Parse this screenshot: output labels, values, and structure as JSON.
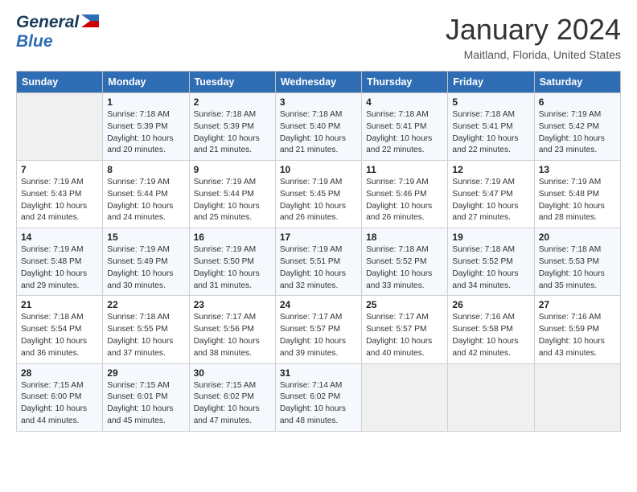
{
  "header": {
    "logo_line1": "General",
    "logo_line2": "Blue",
    "month_year": "January 2024",
    "location": "Maitland, Florida, United States"
  },
  "days_of_week": [
    "Sunday",
    "Monday",
    "Tuesday",
    "Wednesday",
    "Thursday",
    "Friday",
    "Saturday"
  ],
  "weeks": [
    [
      {
        "day": "",
        "info": ""
      },
      {
        "day": "1",
        "info": "Sunrise: 7:18 AM\nSunset: 5:39 PM\nDaylight: 10 hours\nand 20 minutes."
      },
      {
        "day": "2",
        "info": "Sunrise: 7:18 AM\nSunset: 5:39 PM\nDaylight: 10 hours\nand 21 minutes."
      },
      {
        "day": "3",
        "info": "Sunrise: 7:18 AM\nSunset: 5:40 PM\nDaylight: 10 hours\nand 21 minutes."
      },
      {
        "day": "4",
        "info": "Sunrise: 7:18 AM\nSunset: 5:41 PM\nDaylight: 10 hours\nand 22 minutes."
      },
      {
        "day": "5",
        "info": "Sunrise: 7:18 AM\nSunset: 5:41 PM\nDaylight: 10 hours\nand 22 minutes."
      },
      {
        "day": "6",
        "info": "Sunrise: 7:19 AM\nSunset: 5:42 PM\nDaylight: 10 hours\nand 23 minutes."
      }
    ],
    [
      {
        "day": "7",
        "info": "Sunrise: 7:19 AM\nSunset: 5:43 PM\nDaylight: 10 hours\nand 24 minutes."
      },
      {
        "day": "8",
        "info": "Sunrise: 7:19 AM\nSunset: 5:44 PM\nDaylight: 10 hours\nand 24 minutes."
      },
      {
        "day": "9",
        "info": "Sunrise: 7:19 AM\nSunset: 5:44 PM\nDaylight: 10 hours\nand 25 minutes."
      },
      {
        "day": "10",
        "info": "Sunrise: 7:19 AM\nSunset: 5:45 PM\nDaylight: 10 hours\nand 26 minutes."
      },
      {
        "day": "11",
        "info": "Sunrise: 7:19 AM\nSunset: 5:46 PM\nDaylight: 10 hours\nand 26 minutes."
      },
      {
        "day": "12",
        "info": "Sunrise: 7:19 AM\nSunset: 5:47 PM\nDaylight: 10 hours\nand 27 minutes."
      },
      {
        "day": "13",
        "info": "Sunrise: 7:19 AM\nSunset: 5:48 PM\nDaylight: 10 hours\nand 28 minutes."
      }
    ],
    [
      {
        "day": "14",
        "info": "Sunrise: 7:19 AM\nSunset: 5:48 PM\nDaylight: 10 hours\nand 29 minutes."
      },
      {
        "day": "15",
        "info": "Sunrise: 7:19 AM\nSunset: 5:49 PM\nDaylight: 10 hours\nand 30 minutes."
      },
      {
        "day": "16",
        "info": "Sunrise: 7:19 AM\nSunset: 5:50 PM\nDaylight: 10 hours\nand 31 minutes."
      },
      {
        "day": "17",
        "info": "Sunrise: 7:19 AM\nSunset: 5:51 PM\nDaylight: 10 hours\nand 32 minutes."
      },
      {
        "day": "18",
        "info": "Sunrise: 7:18 AM\nSunset: 5:52 PM\nDaylight: 10 hours\nand 33 minutes."
      },
      {
        "day": "19",
        "info": "Sunrise: 7:18 AM\nSunset: 5:52 PM\nDaylight: 10 hours\nand 34 minutes."
      },
      {
        "day": "20",
        "info": "Sunrise: 7:18 AM\nSunset: 5:53 PM\nDaylight: 10 hours\nand 35 minutes."
      }
    ],
    [
      {
        "day": "21",
        "info": "Sunrise: 7:18 AM\nSunset: 5:54 PM\nDaylight: 10 hours\nand 36 minutes."
      },
      {
        "day": "22",
        "info": "Sunrise: 7:18 AM\nSunset: 5:55 PM\nDaylight: 10 hours\nand 37 minutes."
      },
      {
        "day": "23",
        "info": "Sunrise: 7:17 AM\nSunset: 5:56 PM\nDaylight: 10 hours\nand 38 minutes."
      },
      {
        "day": "24",
        "info": "Sunrise: 7:17 AM\nSunset: 5:57 PM\nDaylight: 10 hours\nand 39 minutes."
      },
      {
        "day": "25",
        "info": "Sunrise: 7:17 AM\nSunset: 5:57 PM\nDaylight: 10 hours\nand 40 minutes."
      },
      {
        "day": "26",
        "info": "Sunrise: 7:16 AM\nSunset: 5:58 PM\nDaylight: 10 hours\nand 42 minutes."
      },
      {
        "day": "27",
        "info": "Sunrise: 7:16 AM\nSunset: 5:59 PM\nDaylight: 10 hours\nand 43 minutes."
      }
    ],
    [
      {
        "day": "28",
        "info": "Sunrise: 7:15 AM\nSunset: 6:00 PM\nDaylight: 10 hours\nand 44 minutes."
      },
      {
        "day": "29",
        "info": "Sunrise: 7:15 AM\nSunset: 6:01 PM\nDaylight: 10 hours\nand 45 minutes."
      },
      {
        "day": "30",
        "info": "Sunrise: 7:15 AM\nSunset: 6:02 PM\nDaylight: 10 hours\nand 47 minutes."
      },
      {
        "day": "31",
        "info": "Sunrise: 7:14 AM\nSunset: 6:02 PM\nDaylight: 10 hours\nand 48 minutes."
      },
      {
        "day": "",
        "info": ""
      },
      {
        "day": "",
        "info": ""
      },
      {
        "day": "",
        "info": ""
      }
    ]
  ]
}
